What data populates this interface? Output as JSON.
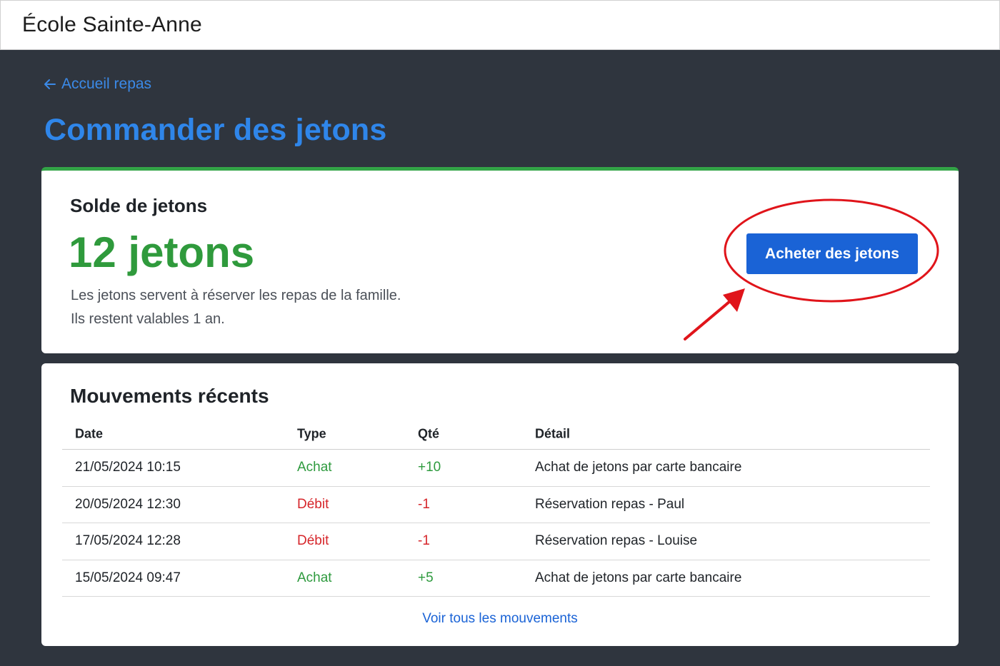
{
  "app": {
    "school_name": "École Sainte-Anne"
  },
  "nav": {
    "back_label": "Accueil repas",
    "back_icon": "arrow-left-icon"
  },
  "page": {
    "title": "Commander des jetons"
  },
  "balance": {
    "label": "Solde de jetons",
    "value": "12 jetons",
    "note_line1": "Les jetons servent à réserver les repas de la famille.",
    "note_line2": "Ils restent valables 1 an.",
    "buy_button_label": "Acheter des jetons"
  },
  "movements": {
    "title": "Mouvements récents",
    "columns": [
      "Date",
      "Type",
      "Qté",
      "Détail"
    ],
    "rows": [
      {
        "date": "21/05/2024 10:15",
        "type": "Achat",
        "qty": "+10",
        "detail": "Achat de jetons par carte bancaire"
      },
      {
        "date": "20/05/2024 12:30",
        "type": "Débit",
        "qty": "-1",
        "detail": "Réservation repas - Paul"
      },
      {
        "date": "17/05/2024 12:28",
        "type": "Débit",
        "qty": "-1",
        "detail": "Réservation repas - Louise"
      },
      {
        "date": "15/05/2024 09:47",
        "type": "Achat",
        "qty": "+5",
        "detail": "Achat de jetons par carte bancaire"
      }
    ],
    "see_all_label": "Voir tous les mouvements"
  },
  "colors": {
    "accent": "#2f86ea",
    "button": "#1a63d6",
    "positive": "#2e9a3e",
    "negative": "#d6262b",
    "annotation": "#e0141a",
    "background": "#2f353e"
  }
}
